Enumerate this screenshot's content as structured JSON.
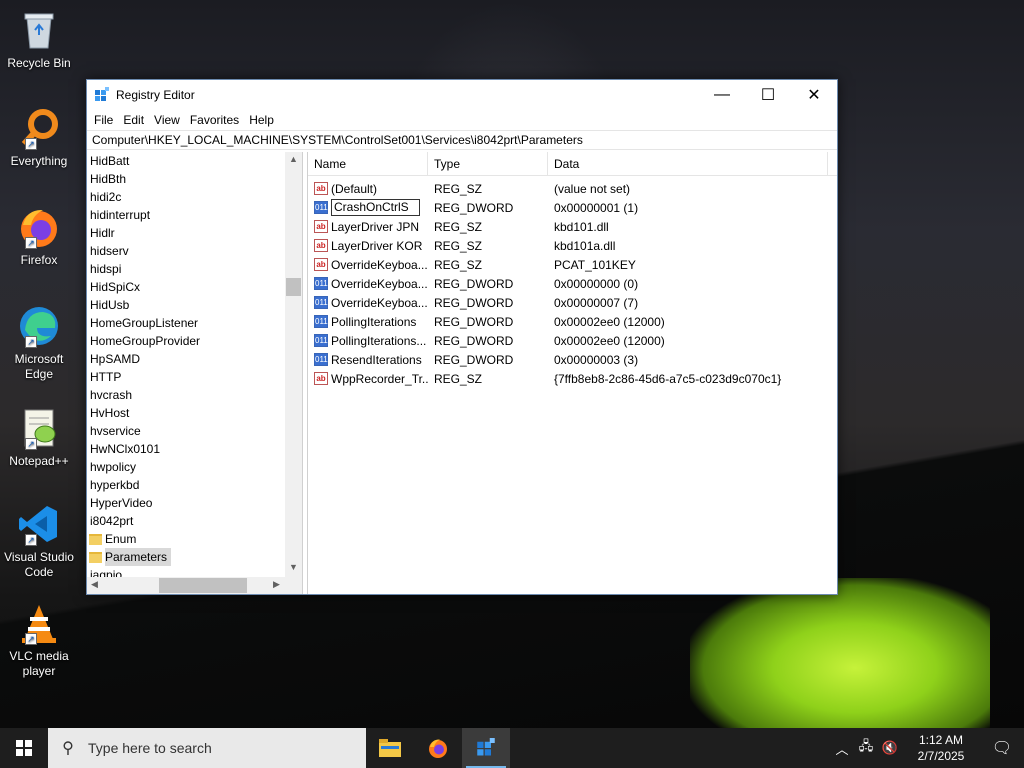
{
  "desktop": {
    "icons": [
      {
        "label": "Recycle Bin",
        "icon": "recycle-bin-icon"
      },
      {
        "label": "Everything",
        "icon": "everything-search-icon"
      },
      {
        "label": "Firefox",
        "icon": "firefox-icon"
      },
      {
        "label": "Microsoft Edge",
        "icon": "edge-icon"
      },
      {
        "label": "Notepad++",
        "icon": "notepad-plus-plus-icon"
      },
      {
        "label": "Visual Studio Code",
        "icon": "vscode-icon"
      },
      {
        "label": "VLC media player",
        "icon": "vlc-icon"
      }
    ]
  },
  "window": {
    "title": "Registry Editor",
    "controls": {
      "minimize": "—",
      "maximize": "☐",
      "close": "✕"
    },
    "menu": [
      "File",
      "Edit",
      "View",
      "Favorites",
      "Help"
    ],
    "address": "Computer\\HKEY_LOCAL_MACHINE\\SYSTEM\\ControlSet001\\Services\\i8042prt\\Parameters",
    "tree": {
      "items": [
        "HidBatt",
        "HidBth",
        "hidi2c",
        "hidinterrupt",
        "Hidlr",
        "hidserv",
        "hidspi",
        "HidSpiCx",
        "HidUsb",
        "HomeGroupListener",
        "HomeGroupProvider",
        "HpSAMD",
        "HTTP",
        "hvcrash",
        "HvHost",
        "hvservice",
        "HwNClx0101",
        "hwpolicy",
        "hyperkbd",
        "HyperVideo",
        "i8042prt"
      ],
      "children": [
        "Enum",
        "Parameters"
      ],
      "selected_child": "Parameters",
      "partial_next": "iagpio"
    },
    "columns": {
      "name": "Name",
      "type": "Type",
      "data": "Data"
    },
    "values": [
      {
        "name": "(Default)",
        "type": "REG_SZ",
        "data": "(value not set)",
        "kind": "sz"
      },
      {
        "name": "CrashOnCtrlS",
        "type": "REG_DWORD",
        "data": "0x00000001 (1)",
        "kind": "dword",
        "editing": true
      },
      {
        "name": "LayerDriver JPN",
        "type": "REG_SZ",
        "data": "kbd101.dll",
        "kind": "sz"
      },
      {
        "name": "LayerDriver KOR",
        "type": "REG_SZ",
        "data": "kbd101a.dll",
        "kind": "sz"
      },
      {
        "name": "OverrideKeyboa...",
        "type": "REG_SZ",
        "data": "PCAT_101KEY",
        "kind": "sz"
      },
      {
        "name": "OverrideKeyboa...",
        "type": "REG_DWORD",
        "data": "0x00000000 (0)",
        "kind": "dword"
      },
      {
        "name": "OverrideKeyboa...",
        "type": "REG_DWORD",
        "data": "0x00000007 (7)",
        "kind": "dword"
      },
      {
        "name": "PollingIterations",
        "type": "REG_DWORD",
        "data": "0x00002ee0 (12000)",
        "kind": "dword"
      },
      {
        "name": "PollingIterations...",
        "type": "REG_DWORD",
        "data": "0x00002ee0 (12000)",
        "kind": "dword"
      },
      {
        "name": "ResendIterations",
        "type": "REG_DWORD",
        "data": "0x00000003 (3)",
        "kind": "dword"
      },
      {
        "name": "WppRecorder_Tr...",
        "type": "REG_SZ",
        "data": "{7ffb8eb8-2c86-45d6-a7c5-c023d9c070c1}",
        "kind": "sz"
      }
    ],
    "icon_text": {
      "sz": "ab",
      "dword": "011"
    }
  },
  "taskbar": {
    "search_placeholder": "Type here to search",
    "apps": [
      "file-explorer-icon",
      "firefox-icon",
      "registry-editor-icon"
    ],
    "clock": {
      "time": "1:12 AM",
      "date": "2/7/2025"
    }
  }
}
